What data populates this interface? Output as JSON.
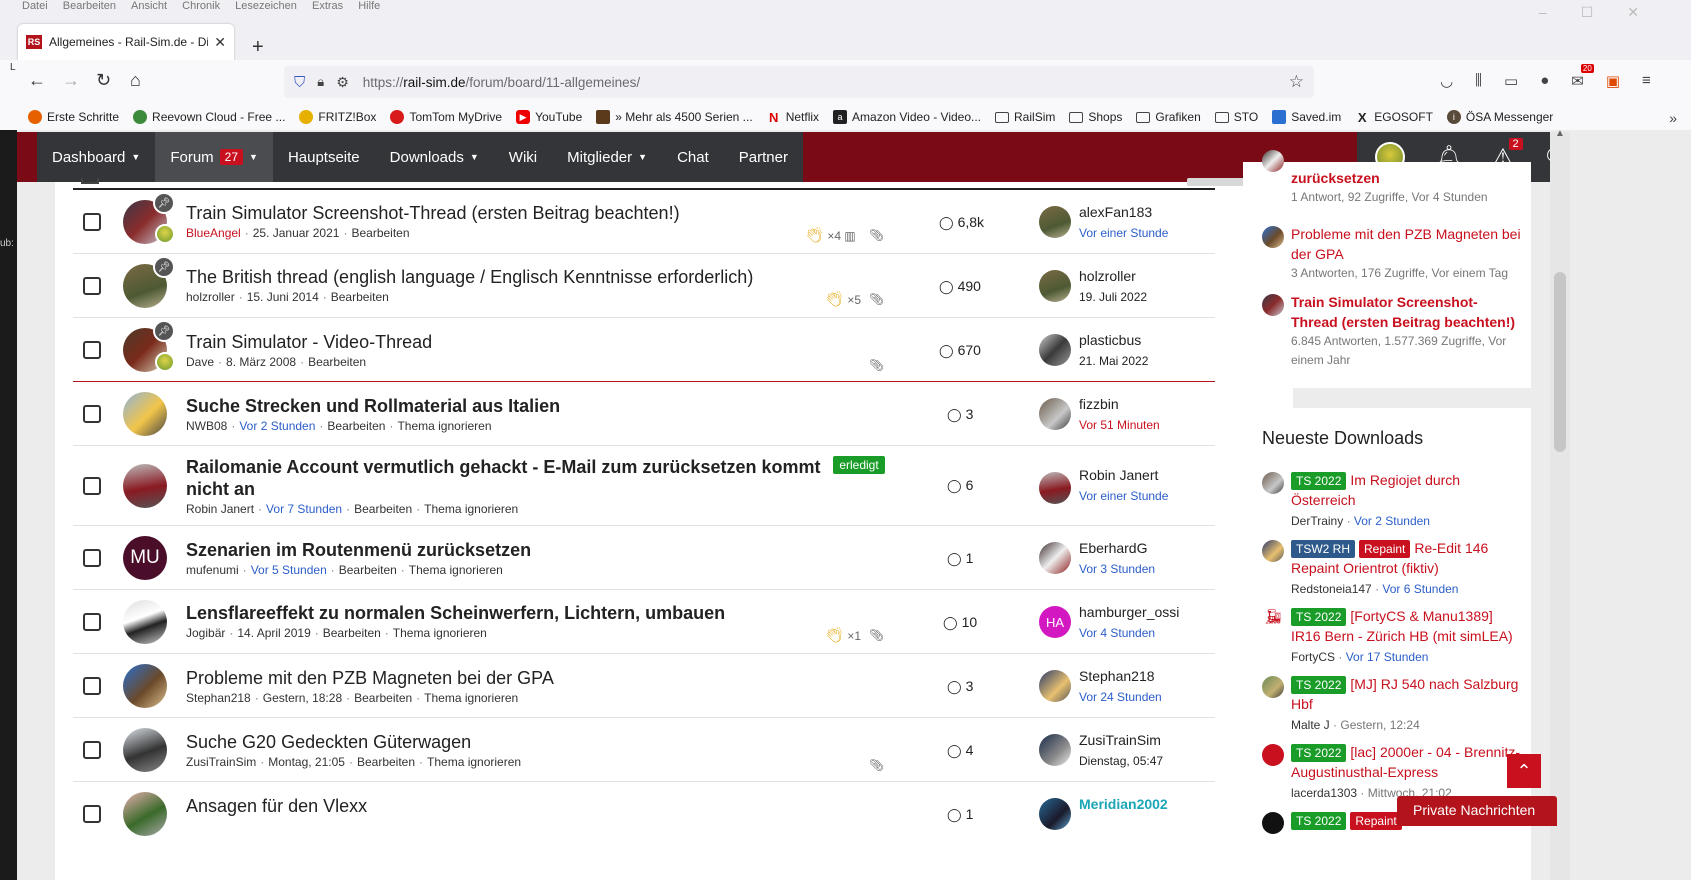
{
  "browser": {
    "menu": [
      "Datei",
      "Bearbeiten",
      "Ansicht",
      "Chronik",
      "Lesezeichen",
      "Extras",
      "Hilfe"
    ],
    "tab_title": "Allgemeines - Rail-Sim.de - Die",
    "favicon": "RS",
    "url_prefix": "https://",
    "url_domain": "rail-sim.de",
    "url_path": "/forum/board/11-allgemeines/",
    "toolbar_badge": "20",
    "bookmarks": [
      {
        "label": "Erste Schritte",
        "icon": "firefox-icon",
        "color": "#e66000"
      },
      {
        "label": "Reevown Cloud - Free ...",
        "icon": "cloud-icon",
        "color": "#3c8a3c"
      },
      {
        "label": "FRITZ!Box",
        "icon": "fritzbox-icon",
        "color": "#e6b000"
      },
      {
        "label": "TomTom MyDrive",
        "icon": "tomtom-icon",
        "color": "#d81a1a"
      },
      {
        "label": "YouTube",
        "icon": "youtube-icon",
        "color": "#e00"
      },
      {
        "label": "» Mehr als 4500 Serien ...",
        "icon": "series-icon",
        "color": "#5a3a1a"
      },
      {
        "label": "Netflix",
        "icon": "netflix-icon",
        "color": "#d00"
      },
      {
        "label": "Amazon Video - Video...",
        "icon": "amazon-icon",
        "color": "#222"
      },
      {
        "label": "RailSim",
        "icon": "folder-icon",
        "color": ""
      },
      {
        "label": "Shops",
        "icon": "folder-icon",
        "color": ""
      },
      {
        "label": "Grafiken",
        "icon": "folder-icon",
        "color": ""
      },
      {
        "label": "STO",
        "icon": "folder-icon",
        "color": ""
      },
      {
        "label": "Saved.im",
        "icon": "saved-icon",
        "color": "#2b6fd0"
      },
      {
        "label": "EGOSOFT",
        "icon": "egosoft-icon",
        "color": "#222"
      },
      {
        "label": "ÖSA Messenger",
        "icon": "info-icon",
        "color": "#5a4a3a"
      }
    ]
  },
  "left_strip": {
    "a": "L",
    "b": "ub:"
  },
  "site_nav": {
    "items": [
      {
        "label": "Dashboard",
        "caret": true
      },
      {
        "label": "Forum",
        "caret": true,
        "count": "27",
        "active": true
      },
      {
        "label": "Hauptseite"
      },
      {
        "label": "Downloads",
        "caret": true
      },
      {
        "label": "Wiki"
      },
      {
        "label": "Mitglieder",
        "caret": true
      },
      {
        "label": "Chat"
      },
      {
        "label": "Partner"
      }
    ],
    "alerts_count": "2"
  },
  "threads": [
    {
      "title": "Train Simulator Screenshot-Thread (ersten Beitrag beachten!)",
      "unread": false,
      "sticky": true,
      "author": "BlueAngel",
      "author_red": true,
      "date": "25. Januar 2021",
      "actions": [
        "Bearbeiten"
      ],
      "likes": "×4",
      "stats_icon": true,
      "clip": true,
      "replies": "6,8k",
      "last_user": "alexFan183",
      "last_time": "Vor einer Stunde",
      "last_time_style": "blue"
    },
    {
      "title": "The British thread (english language / Englisch Kenntnisse erforderlich)",
      "unread": false,
      "sticky": true,
      "author": "holzroller",
      "date": "15. Juni 2014",
      "actions": [
        "Bearbeiten"
      ],
      "likes": "×5",
      "clip": true,
      "replies": "490",
      "last_user": "holzroller",
      "last_time": "19. Juli 2022",
      "last_time_style": "dark"
    },
    {
      "title": "Train Simulator - Video-Thread",
      "unread": false,
      "sticky": true,
      "author": "Dave",
      "date": "8. März 2008",
      "actions": [
        "Bearbeiten"
      ],
      "clip": true,
      "replies": "670",
      "last_user": "plasticbus",
      "last_time": "21. Mai 2022",
      "last_time_style": "dark"
    },
    {
      "title": "Suche Strecken und Rollmaterial aus Italien",
      "unread": true,
      "author": "NWB08",
      "date": "Vor 2 Stunden",
      "date_blue": true,
      "actions": [
        "Bearbeiten",
        "Thema ignorieren"
      ],
      "replies": "3",
      "last_user": "fizzbin",
      "last_time": "Vor 51 Minuten",
      "last_time_style": "red"
    },
    {
      "title": "Railomanie Account vermutlich gehackt - E-Mail zum zurücksetzen kommt",
      "title2": "nicht an",
      "unread": true,
      "badge": "erledigt",
      "author": "Robin Janert",
      "date": "Vor 7 Stunden",
      "date_blue": true,
      "actions": [
        "Bearbeiten",
        "Thema ignorieren"
      ],
      "replies": "6",
      "last_user": "Robin Janert",
      "last_time": "Vor einer Stunde",
      "last_time_style": "blue"
    },
    {
      "title": "Szenarien im Routenmenü zurücksetzen",
      "unread": true,
      "initials": "MU",
      "author": "mufenumi",
      "date": "Vor 5 Stunden",
      "date_blue": true,
      "actions": [
        "Bearbeiten",
        "Thema ignorieren"
      ],
      "replies": "1",
      "last_user": "EberhardG",
      "last_time": "Vor 3 Stunden",
      "last_time_style": "blue"
    },
    {
      "title": "Lensflareeffekt zu normalen Scheinwerfern, Lichtern, umbauen",
      "unread": true,
      "author": "Jogibär",
      "date": "14. April 2019",
      "actions": [
        "Bearbeiten",
        "Thema ignorieren"
      ],
      "likes": "×1",
      "clip": true,
      "replies": "10",
      "last_user": "hamburger_ossi",
      "last_initials": "HA",
      "last_time": "Vor 4 Stunden",
      "last_time_style": "blue"
    },
    {
      "title": "Probleme mit den PZB Magneten bei der GPA",
      "unread": false,
      "author": "Stephan218",
      "date": "Gestern, 18:28",
      "actions": [
        "Bearbeiten",
        "Thema ignorieren"
      ],
      "replies": "3",
      "last_user": "Stephan218",
      "last_time": "Vor 24 Stunden",
      "last_time_style": "blue"
    },
    {
      "title": "Suche G20 Gedeckten Güterwagen",
      "unread": false,
      "author": "ZusiTrainSim",
      "date": "Montag, 21:05",
      "actions": [
        "Bearbeiten",
        "Thema ignorieren"
      ],
      "clip": true,
      "replies": "4",
      "last_user": "ZusiTrainSim",
      "last_time": "Dienstag, 05:47",
      "last_time_style": "dark"
    },
    {
      "title": "Ansagen für den Vlexx",
      "unread": false,
      "author": "",
      "date": "",
      "actions": [],
      "replies": "1",
      "last_user": "Meridian2002",
      "last_user_teal": true,
      "last_time": "",
      "last_time_style": "dark"
    }
  ],
  "sidebar": {
    "recent": [
      {
        "title": "zurücksetzen",
        "bold": true,
        "meta": "1 Antwort, 92 Zugriffe, Vor 4 Stunden"
      },
      {
        "title": "Probleme mit den PZB Magneten bei der GPA",
        "bold": false,
        "meta": "3 Antworten, 176 Zugriffe, Vor einem Tag"
      },
      {
        "title": "Train Simulator Screenshot-Thread (ersten Beitrag beachten!)",
        "bold": true,
        "meta": "6.845 Antworten, 1.577.369 Zugriffe, Vor einem Jahr"
      }
    ],
    "downloads_heading": "Neueste Downloads",
    "downloads": [
      {
        "labels": [
          {
            "t": "TS 2022",
            "c": "g"
          }
        ],
        "title": "Im Regiojet durch Österreich",
        "user": "DerTrainy",
        "time": "Vor 2 Stunden",
        "time_blue": true
      },
      {
        "labels": [
          {
            "t": "TSW2 RH",
            "c": "b"
          },
          {
            "t": "Repaint",
            "c": "r"
          }
        ],
        "title": "Re-Edit 146 Repaint Orientrot (fiktiv)",
        "user": "Redstoneia147",
        "time": "Vor 6 Stunden",
        "time_blue": true
      },
      {
        "labels": [
          {
            "t": "TS 2022",
            "c": "g"
          }
        ],
        "title": "[FortyCS & Manu1389] IR16 Bern - Zürich HB (mit simLEA)",
        "user": "FortyCS",
        "time": "Vor 17 Stunden",
        "time_blue": true
      },
      {
        "labels": [
          {
            "t": "TS 2022",
            "c": "g"
          }
        ],
        "title": "[MJ] RJ 540 nach Salzburg Hbf",
        "user": "Malte J",
        "time": "Gestern, 12:24",
        "time_blue": false
      },
      {
        "labels": [
          {
            "t": "TS 2022",
            "c": "g"
          }
        ],
        "title": "[lac] 2000er - 04 - Brennitz-Augustinusthal-Express",
        "user": "lacerda1303",
        "time": "Mittwoch, 21:02",
        "time_blue": false
      },
      {
        "labels": [
          {
            "t": "TS 2022",
            "c": "g"
          },
          {
            "t": "Repaint",
            "c": "r"
          }
        ],
        "title": "",
        "user": "",
        "time": "",
        "time_blue": false
      }
    ]
  },
  "pm_button": "Private Nachrichten",
  "to_top_icon": "arrow-up-icon"
}
